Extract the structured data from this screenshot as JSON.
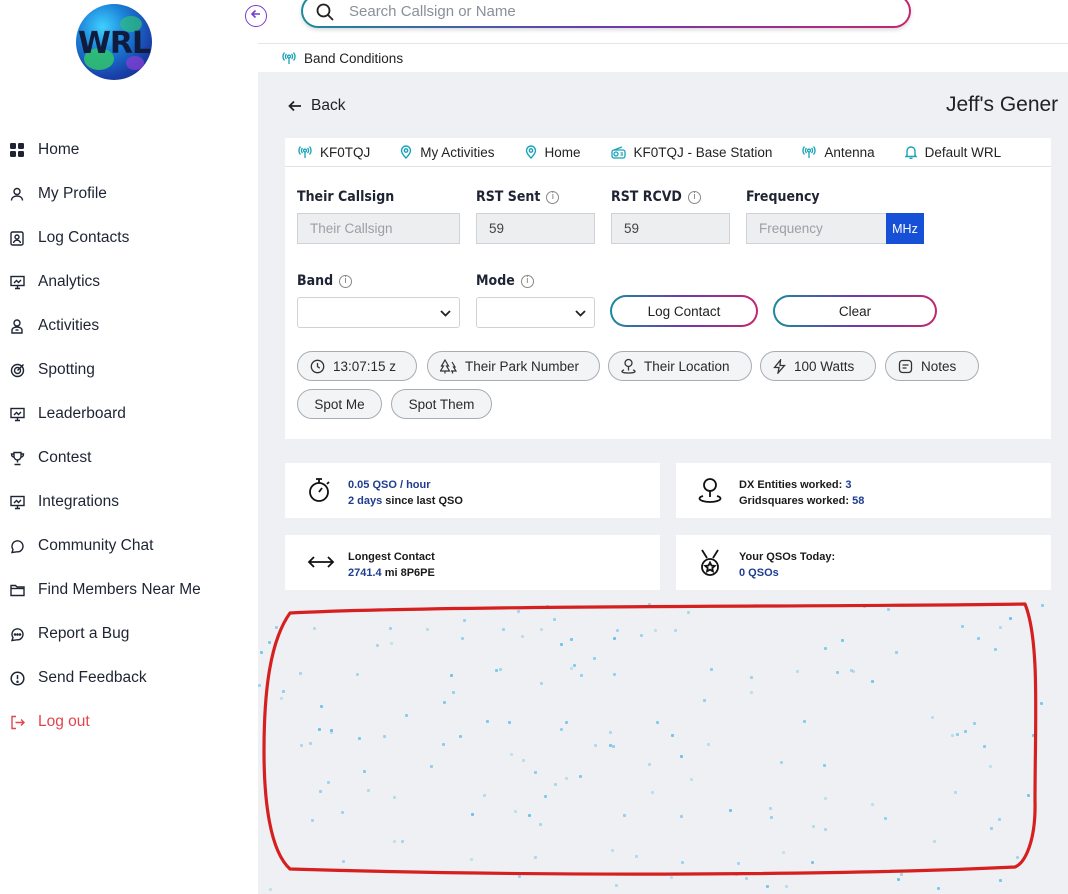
{
  "logo": {
    "text": "WRL"
  },
  "search": {
    "placeholder": "Search Callsign or Name"
  },
  "sidebar": {
    "items": [
      {
        "label": "Home",
        "icon": "grid-icon"
      },
      {
        "label": "My Profile",
        "icon": "user-icon"
      },
      {
        "label": "Log Contacts",
        "icon": "contact-card-icon"
      },
      {
        "label": "Analytics",
        "icon": "presentation-chart-icon"
      },
      {
        "label": "Activities",
        "icon": "person-badge-icon"
      },
      {
        "label": "Spotting",
        "icon": "target-icon"
      },
      {
        "label": "Leaderboard",
        "icon": "presentation-chart-icon"
      },
      {
        "label": "Contest",
        "icon": "trophy-icon"
      },
      {
        "label": "Integrations",
        "icon": "presentation-chart-icon"
      },
      {
        "label": "Community Chat",
        "icon": "chat-icon"
      },
      {
        "label": "Find Members Near Me",
        "icon": "folder-icon"
      },
      {
        "label": "Report a Bug",
        "icon": "chat-dots-icon"
      },
      {
        "label": "Send Feedback",
        "icon": "alert-circle-icon"
      },
      {
        "label": "Log out",
        "icon": "logout-icon"
      }
    ]
  },
  "bandbar": {
    "label": "Band Conditions"
  },
  "back_label": "Back",
  "page_title": "Jeff's Gener",
  "tabs": [
    {
      "label": "KF0TQJ",
      "icon": "antenna-icon"
    },
    {
      "label": "My Activities",
      "icon": "location-pin-icon"
    },
    {
      "label": "Home",
      "icon": "location-pin-icon"
    },
    {
      "label": "KF0TQJ - Base Station",
      "icon": "radio-icon"
    },
    {
      "label": "Antenna",
      "icon": "antenna-icon"
    },
    {
      "label": "Default WRL",
      "icon": "bell-icon"
    }
  ],
  "form": {
    "their_callsign": {
      "label": "Their Callsign",
      "placeholder": "Their Callsign"
    },
    "rst_sent": {
      "label": "RST Sent",
      "value": "59"
    },
    "rst_rcvd": {
      "label": "RST RCVD",
      "value": "59"
    },
    "frequency": {
      "label": "Frequency",
      "placeholder": "Frequency",
      "unit": "MHz"
    },
    "band": {
      "label": "Band",
      "value": ""
    },
    "mode": {
      "label": "Mode",
      "value": ""
    },
    "log_contact": "Log Contact",
    "clear": "Clear"
  },
  "pills": [
    {
      "label": "13:07:15 z",
      "icon": "clock-icon"
    },
    {
      "label": "Their Park Number",
      "icon": "trees-icon"
    },
    {
      "label": "Their Location",
      "icon": "map-pin-icon"
    },
    {
      "label": "100 Watts",
      "icon": "lightning-icon"
    },
    {
      "label": "Notes",
      "icon": "note-icon"
    },
    {
      "label": "Spot Me",
      "icon": ""
    },
    {
      "label": "Spot Them",
      "icon": ""
    }
  ],
  "stats": {
    "rate": {
      "value": "0.05 QSO",
      "suffix": " / hour",
      "since_value": "2 days",
      "since_suffix": " since last QSO"
    },
    "dx": {
      "entities_label": "DX Entities worked: ",
      "entities_value": "3",
      "grid_label": "Gridsquares worked: ",
      "grid_value": "58"
    },
    "longest": {
      "label": "Longest Contact",
      "value": "2741.4",
      "suffix": " mi 8P6PE"
    },
    "today": {
      "label": "Your QSOs Today:",
      "value": "0 QSOs"
    }
  },
  "colors": {
    "accent": "#1550d6",
    "logout": "#e0464e",
    "annotation": "#d62020",
    "value_text": "#1f3d8f"
  }
}
